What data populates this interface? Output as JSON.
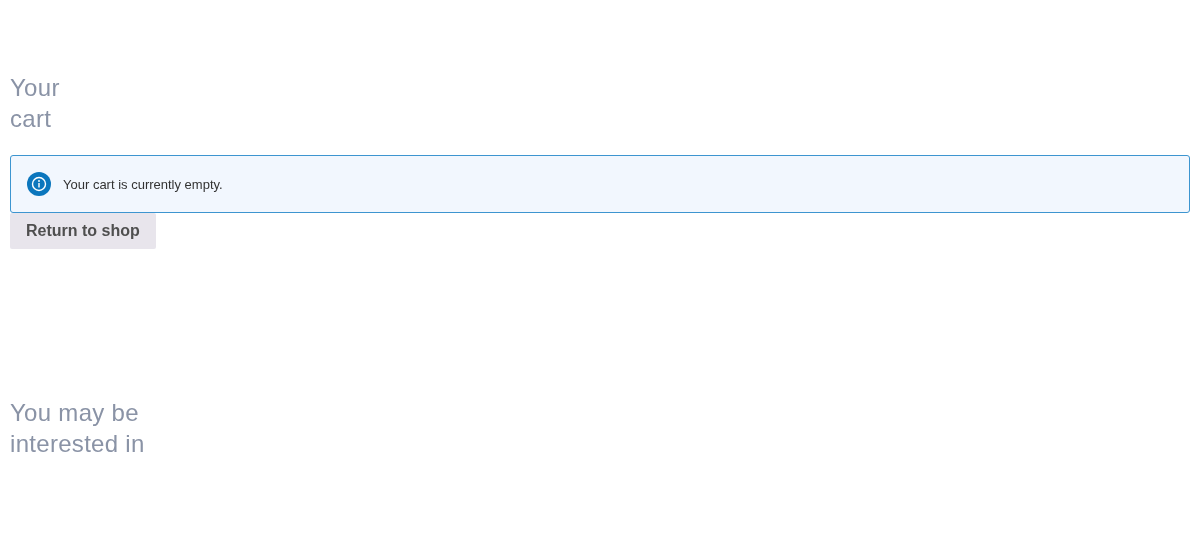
{
  "cart": {
    "title": "Your cart",
    "notice": {
      "kind": "info",
      "message": "Your cart is currently empty."
    },
    "return_button": {
      "label": "Return to shop"
    }
  },
  "related": {
    "title": "You may be interested in"
  }
}
